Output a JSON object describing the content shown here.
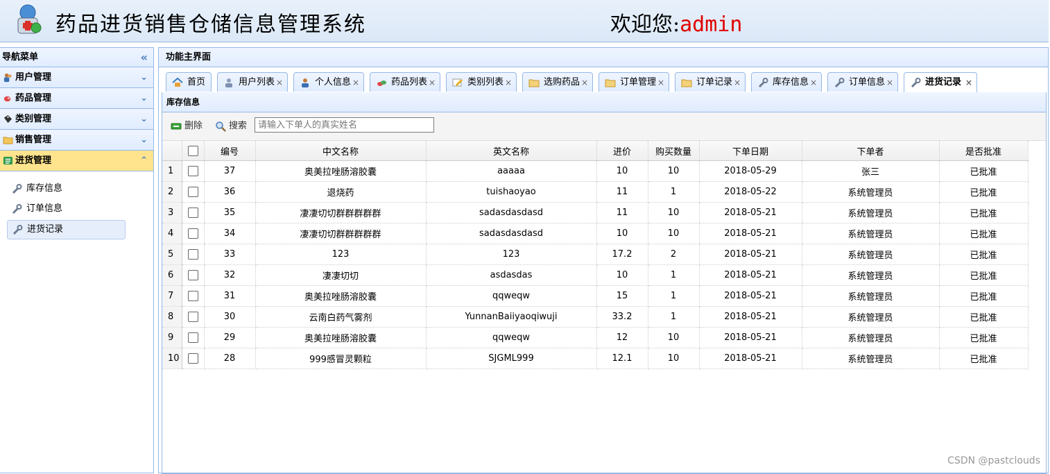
{
  "header": {
    "app_title": "药品进货销售仓储信息管理系统",
    "welcome_prefix": "欢迎您:",
    "username": "admin"
  },
  "sidebar": {
    "title": "导航菜单",
    "collapse_icon": "double-chevron-left-icon",
    "menus": [
      {
        "label": "用户管理",
        "icon": "users-icon"
      },
      {
        "label": "药品管理",
        "icon": "pills-icon"
      },
      {
        "label": "类别管理",
        "icon": "tag-icon"
      },
      {
        "label": "销售管理",
        "icon": "folder-icon"
      },
      {
        "label": "进货管理",
        "icon": "list-icon"
      }
    ],
    "items": [
      {
        "label": "库存信息"
      },
      {
        "label": "订单信息"
      },
      {
        "label": "进货记录"
      }
    ]
  },
  "main": {
    "title": "功能主界面",
    "tabs": [
      {
        "label": "首页",
        "icon": "home-icon"
      },
      {
        "label": "用户列表",
        "icon": "users-icon"
      },
      {
        "label": "个人信息",
        "icon": "user-icon"
      },
      {
        "label": "药品列表",
        "icon": "pills-icon"
      },
      {
        "label": "类别列表",
        "icon": "pencil-icon"
      },
      {
        "label": "选购药品",
        "icon": "folder-icon"
      },
      {
        "label": "订单管理",
        "icon": "folder-icon"
      },
      {
        "label": "订单记录",
        "icon": "folder-icon"
      },
      {
        "label": "库存信息",
        "icon": "wrench-icon"
      },
      {
        "label": "订单信息",
        "icon": "wrench-icon"
      },
      {
        "label": "进货记录",
        "icon": "wrench-icon"
      }
    ],
    "close_glyph": "×"
  },
  "grid": {
    "title": "库存信息",
    "toolbar": {
      "delete_label": "删除",
      "search_label": "搜索",
      "search_placeholder": "请输入下单人的真实姓名"
    },
    "columns": [
      "编号",
      "中文名称",
      "英文名称",
      "进价",
      "购买数量",
      "下单日期",
      "下单者",
      "是否批准"
    ],
    "rows": [
      [
        "37",
        "奥美拉唑肠溶胶囊",
        "aaaaa",
        "10",
        "10",
        "2018-05-29",
        "张三",
        "已批准"
      ],
      [
        "36",
        "退烧药",
        "tuishaoyao",
        "11",
        "1",
        "2018-05-22",
        "系统管理员",
        "已批准"
      ],
      [
        "35",
        "凄凄切切群群群群群",
        "sadasdasdasd",
        "11",
        "10",
        "2018-05-21",
        "系统管理员",
        "已批准"
      ],
      [
        "34",
        "凄凄切切群群群群群",
        "sadasdasdasd",
        "10",
        "10",
        "2018-05-21",
        "系统管理员",
        "已批准"
      ],
      [
        "33",
        "123",
        "123",
        "17.2",
        "2",
        "2018-05-21",
        "系统管理员",
        "已批准"
      ],
      [
        "32",
        "凄凄切切",
        "asdasdas",
        "10",
        "1",
        "2018-05-21",
        "系统管理员",
        "已批准"
      ],
      [
        "31",
        "奥美拉唑肠溶胶囊",
        "qqweqw",
        "15",
        "1",
        "2018-05-21",
        "系统管理员",
        "已批准"
      ],
      [
        "30",
        "云南白药气雾剂",
        "YunnanBaiiyaoqiwuji",
        "33.2",
        "1",
        "2018-05-21",
        "系统管理员",
        "已批准"
      ],
      [
        "29",
        "奥美拉唑肠溶胶囊",
        "qqweqw",
        "12",
        "10",
        "2018-05-21",
        "系统管理员",
        "已批准"
      ],
      [
        "28",
        "999感冒灵颗粒",
        "SJGML999",
        "12.1",
        "10",
        "2018-05-21",
        "系统管理员",
        "已批准"
      ]
    ]
  },
  "watermark": "CSDN @pastclouds",
  "colors": {
    "accent": "#95b8e7",
    "selected": "#ffe48d",
    "username": "#e00000"
  }
}
